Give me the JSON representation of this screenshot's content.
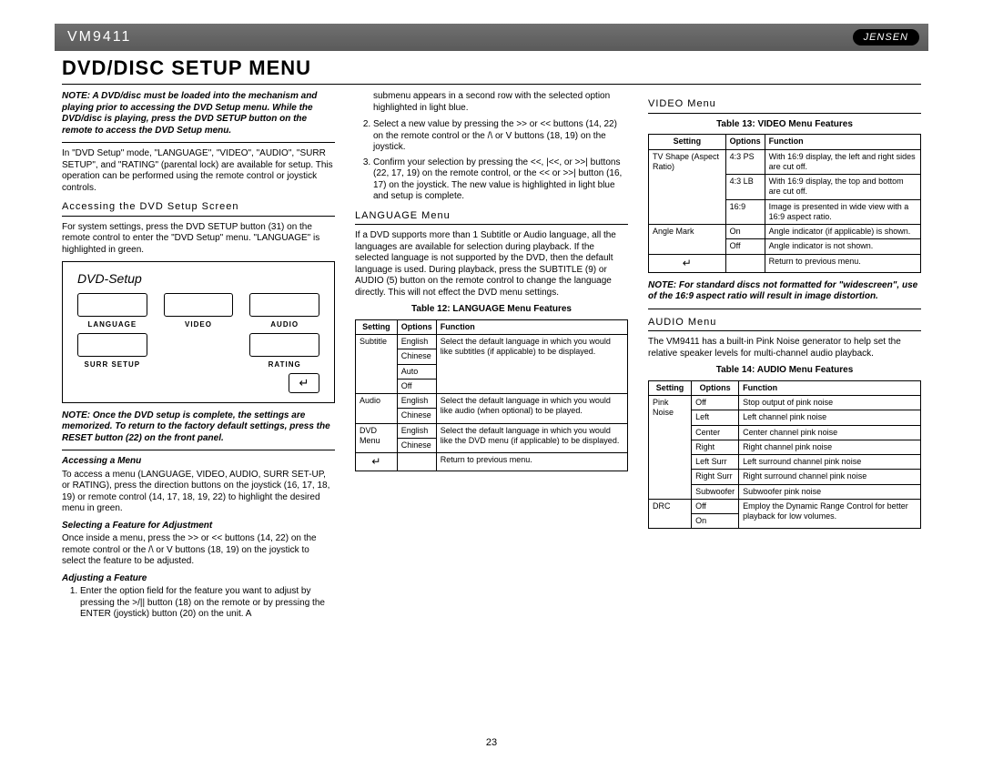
{
  "header": {
    "model": "VM9411",
    "brand": "JENSEN"
  },
  "title": "Dvd/Disc Setup Menu",
  "page_number": "23",
  "col1": {
    "note_top": "NOTE: A DVD/disc must be loaded into the mechanism and playing prior to accessing the DVD Setup menu. While the DVD/disc is playing, press the DVD SETUP button on the remote to access the DVD Setup menu.",
    "intro": "In \"DVD Setup\" mode, \"LANGUAGE\", \"VIDEO\", \"AUDIO\", \"SURR SETUP\", and \"RATING\" (parental lock) are available for setup. This operation can be performed using the remote control or joystick controls.",
    "access_head": "Accessing the DVD Setup Screen",
    "access_p": "For system settings, press the DVD SETUP button (31) on the remote control to enter the \"DVD Setup\" menu. \"LANGUAGE\" is highlighted in green.",
    "diagram": {
      "title": "DVD-Setup",
      "tiles": {
        "language": "LANGUAGE",
        "video": "VIDEO",
        "audio": "AUDIO",
        "surr": "SURR SETUP",
        "rating": "RATING"
      }
    },
    "note_bottom": "NOTE: Once the DVD setup is complete, the settings are memorized. To return to the factory default settings, press the RESET button (22) on the front panel.",
    "accessing_menu_head": "Accessing a Menu",
    "accessing_menu_p": "To access a menu (LANGUAGE, VIDEO, AUDIO, SURR SET-UP, or RATING), press the direction buttons on the joystick (16, 17, 18, 19) or remote control (14, 17, 18, 19, 22) to highlight the desired menu in green.",
    "selecting_head": "Selecting a Feature for Adjustment",
    "selecting_p": "Once inside a menu, press the >> or << buttons (14, 22) on the remote control or the /\\ or V buttons (18, 19) on the joystick to select the feature to be adjusted.",
    "adjusting_head": "Adjusting a Feature",
    "adj_item1": "Enter the option field for the feature you want to adjust by pressing the >/|| button (18) on the remote or by pressing the ENTER (joystick) button (20) on the unit. A"
  },
  "col2": {
    "cont1": "submenu appears in a second row with the selected option highlighted in light blue.",
    "adj_item2": "Select a new value by pressing the >> or << buttons (14, 22) on the remote control or the /\\ or V buttons (18, 19) on the joystick.",
    "adj_item3": "Confirm your selection by pressing the <<, |<<, or >>| buttons (22, 17, 19) on the remote control, or the << or >>| button (16, 17) on the joystick. The new value is highlighted in light blue and setup is complete.",
    "lang_head": "LANGUAGE Menu",
    "lang_p": "If a DVD supports more than 1 Subtitle or Audio language, all the languages are available for selection during playback. If the selected language is not supported by the DVD, then the default language is used. During playback, press the SUBTITLE (9) or AUDIO (5) button on the remote control to change the language directly. This will not effect the DVD menu settings.",
    "tbl12_caption": "Table 12: LANGUAGE Menu Features",
    "tbl_headers": {
      "setting": "Setting",
      "options": "Options",
      "function": "Function"
    },
    "tbl12": {
      "subtitle_label": "Subtitle",
      "subtitle_func": "Select the default language in which you would like subtitles (if applicable) to be displayed.",
      "subtitle_opts": [
        "English",
        "Chinese",
        "Auto",
        "Off"
      ],
      "audio_label": "Audio",
      "audio_func": "Select the default language in which you would like audio (when optional) to be played.",
      "audio_opts": [
        "English",
        "Chinese"
      ],
      "dvdmenu_label": "DVD Menu",
      "dvdmenu_func": "Select the default language in which you would like the DVD menu (if applicable) to be displayed.",
      "dvdmenu_opts": [
        "English",
        "Chinese"
      ],
      "return_func": "Return to previous menu."
    }
  },
  "col3": {
    "video_head": "VIDEO Menu",
    "tbl13_caption": "Table 13: VIDEO Menu Features",
    "tbl13": {
      "tvshape_label": "TV Shape (Aspect Ratio)",
      "r1_opt": "4:3 PS",
      "r1_func": "With 16:9 display, the left and right sides are cut off.",
      "r2_opt": "4:3 LB",
      "r2_func": "With 16:9 display, the top and bottom are cut off.",
      "r3_opt": "16:9",
      "r3_func": "Image is presented in wide view with a 16:9 aspect ratio.",
      "angle_label": "Angle Mark",
      "r4_opt": "On",
      "r4_func": "Angle indicator (if applicable) is shown.",
      "r5_opt": "Off",
      "r5_func": "Angle indicator is not shown.",
      "return_func": "Return to previous menu."
    },
    "note_widescreen": "NOTE: For standard discs not formatted for \"widescreen\", use of the 16:9 aspect ratio will result in image distortion.",
    "audio_head": "AUDIO Menu",
    "audio_p": "The VM9411 has a built-in Pink Noise generator to help set the relative speaker levels for multi-channel audio playback.",
    "tbl14_caption": "Table 14: AUDIO Menu Features",
    "tbl14": {
      "pink_label": "Pink Noise",
      "r1_opt": "Off",
      "r1_func": "Stop output of pink noise",
      "r2_opt": "Left",
      "r2_func": "Left channel pink noise",
      "r3_opt": "Center",
      "r3_func": "Center channel pink noise",
      "r4_opt": "Right",
      "r4_func": "Right channel pink noise",
      "r5_opt": "Left Surr",
      "r5_func": "Left surround channel pink noise",
      "r6_opt": "Right Surr",
      "r6_func": "Right surround channel pink noise",
      "r7_opt": "Subwoofer",
      "r7_func": "Subwoofer pink noise",
      "drc_label": "DRC",
      "r8_opt": "Off",
      "r8_func": "Employ the Dynamic Range Control for better playback for low volumes.",
      "r9_opt": "On"
    }
  },
  "return_glyph": "↵"
}
